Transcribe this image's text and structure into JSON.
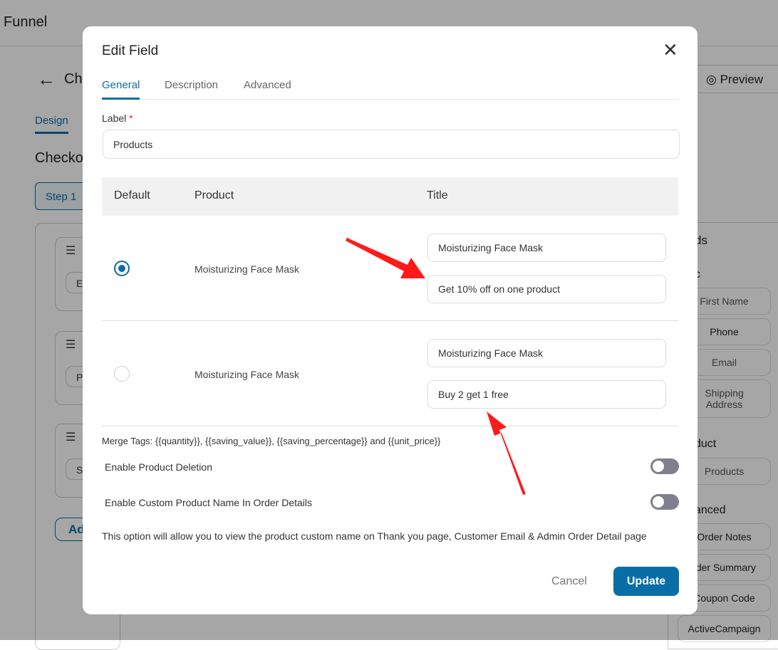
{
  "background": {
    "app_title": "Funnel",
    "page_title_partial": "Ch",
    "tab_design": "Design",
    "section_partial": "Checko",
    "step": "Step 1",
    "cards": [
      {
        "pill": "Er"
      },
      {
        "pill": "Pr"
      },
      {
        "pill": "Sh"
      }
    ],
    "add_partial": "Ad",
    "preview": "Preview",
    "right_panel": {
      "title_partial": "ds",
      "basic_partial": "c",
      "basic_items": [
        "First Name",
        "Phone",
        "Email",
        "Shipping Address"
      ],
      "product_partial": "duct",
      "product_items": [
        "Products"
      ],
      "advanced_partial": "anced",
      "advanced_items": [
        "Order Notes",
        "rder Summary",
        "Coupon Code",
        "ActiveCampaign"
      ]
    }
  },
  "modal": {
    "title": "Edit Field",
    "tabs": [
      {
        "label": "General",
        "active": true
      },
      {
        "label": "Description"
      },
      {
        "label": "Advanced"
      }
    ],
    "label_field": {
      "label": "Label",
      "required": "*",
      "value": "Products"
    },
    "table": {
      "headers": [
        "Default",
        "Product",
        "Title"
      ],
      "rows": [
        {
          "default": true,
          "product": "Moisturizing Face Mask",
          "title": "Moisturizing Face Mask",
          "subtitle": "Get 10% off on one product"
        },
        {
          "default": false,
          "product": "Moisturizing Face Mask",
          "title": "Moisturizing Face Mask",
          "subtitle": "Buy 2 get 1 free"
        }
      ]
    },
    "merge_tags": "Merge Tags: {{quantity}}, {{saving_value}}, {{saving_percentage}} and {{unit_price}}",
    "options": [
      {
        "label": "Enable Product Deletion",
        "enabled": false
      },
      {
        "label": "Enable Custom Product Name In Order Details",
        "enabled": false
      }
    ],
    "note": "This option will allow you to view the product custom name on Thank you page, Customer Email & Admin Order Detail page",
    "cancel": "Cancel",
    "update": "Update"
  },
  "colors": {
    "accent": "#0a6ea6",
    "arrow": "#ff1a1a"
  }
}
